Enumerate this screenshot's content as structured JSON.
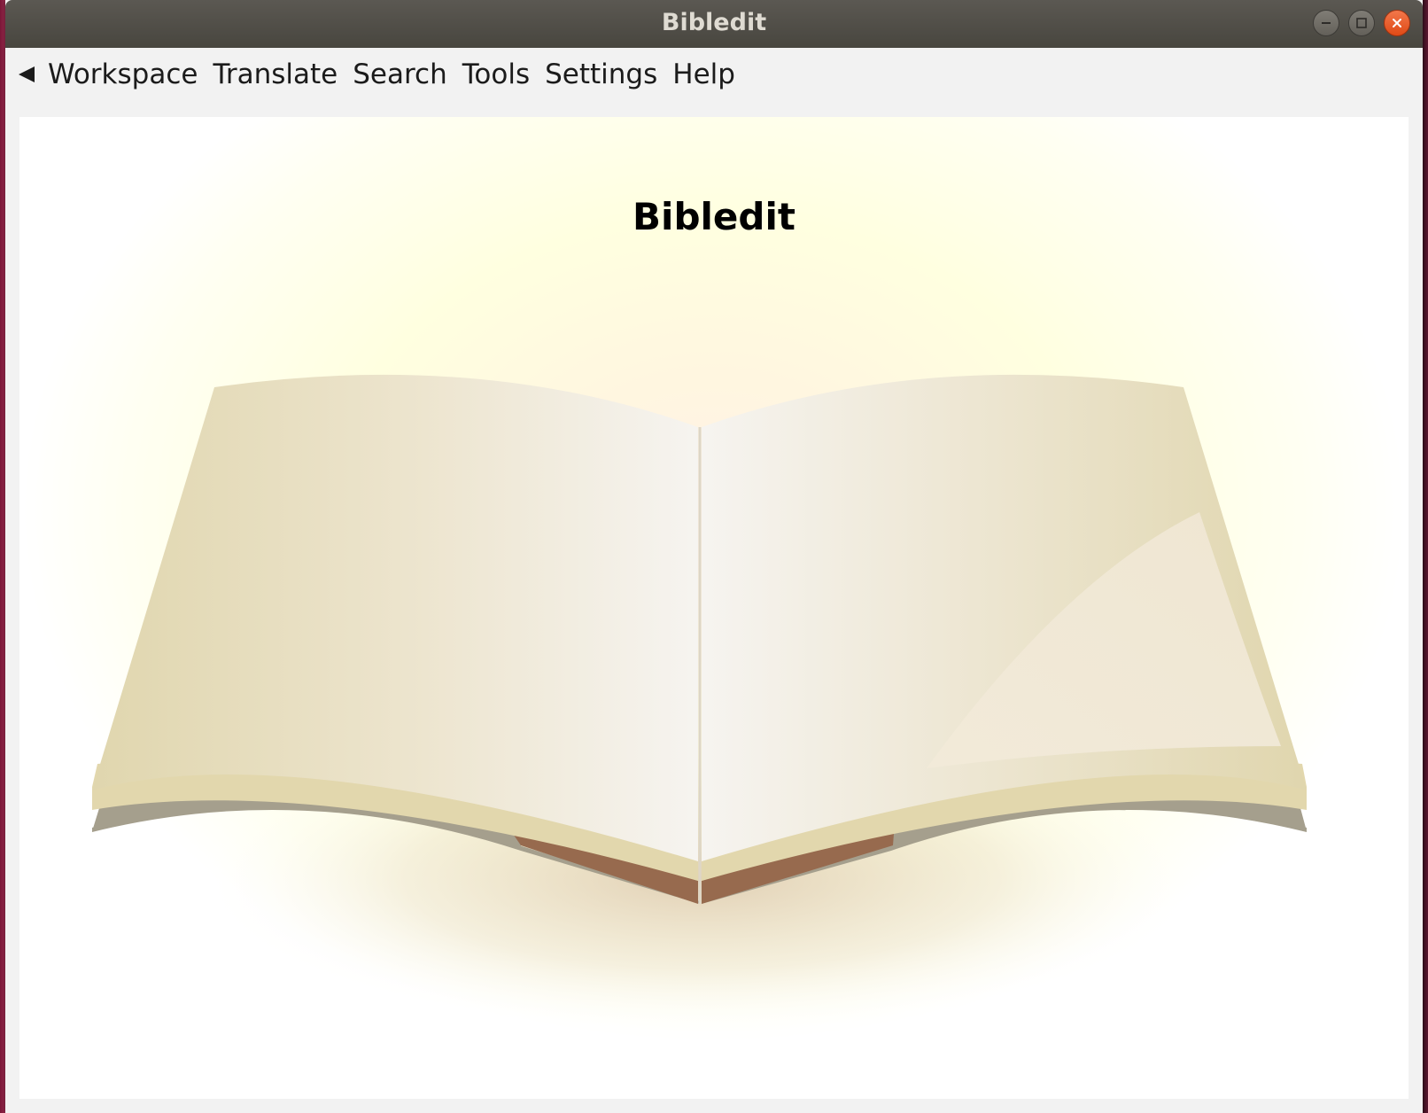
{
  "window": {
    "title": "Bibledit",
    "controls": [
      "minimize-icon",
      "maximize-icon",
      "close-icon"
    ]
  },
  "menubar": {
    "back_icon": "back-arrow-icon",
    "items": [
      {
        "label": "Workspace"
      },
      {
        "label": "Translate"
      },
      {
        "label": "Search"
      },
      {
        "label": "Tools"
      },
      {
        "label": "Settings"
      },
      {
        "label": "Help"
      }
    ]
  },
  "main": {
    "title": "Bibledit",
    "image": "open-book-illustration"
  },
  "colors": {
    "titlebar": "#4f4c46",
    "close_button": "#e95420",
    "page_light": "#f5f3ee",
    "page_dark": "#e2d8b0",
    "book_cover": "#976a4e",
    "page_edge_gray": "#a59f8d"
  }
}
